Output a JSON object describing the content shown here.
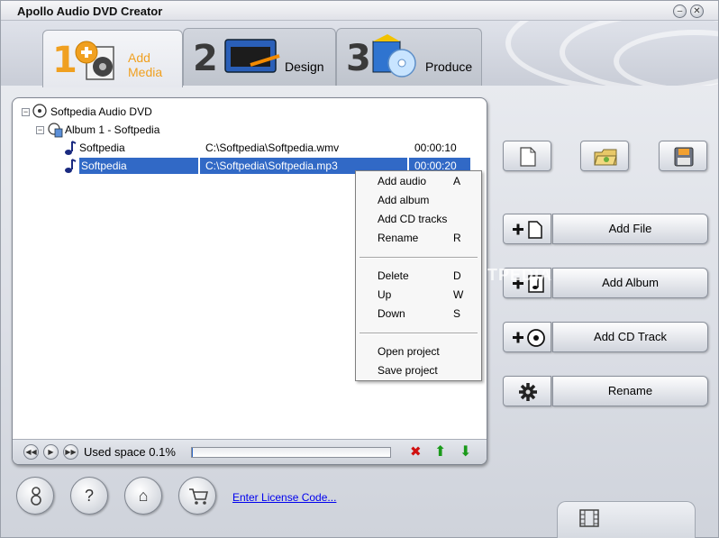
{
  "window": {
    "title": "Apollo Audio DVD Creator",
    "minimize_glyph": "–",
    "close_glyph": "✕"
  },
  "steps": [
    {
      "number": "1",
      "label_line1": "Add",
      "label_line2": "Media",
      "icon": "add-media-icon",
      "active": true
    },
    {
      "number": "2",
      "label": "Design",
      "icon": "design-icon",
      "active": false
    },
    {
      "number": "3",
      "label": "Produce",
      "icon": "produce-icon",
      "active": false
    }
  ],
  "tree": {
    "root": "Softpedia Audio DVD",
    "album": "Album 1 - Softpedia",
    "tracks": [
      {
        "name": "Softpedia",
        "path": "C:\\Softpedia\\Softpedia.wmv",
        "duration": "00:00:10",
        "selected": false
      },
      {
        "name": "Softpedia",
        "path": "C:\\Softpedia\\Softpedia.mp3",
        "duration": "00:00:20",
        "selected": true
      }
    ],
    "collapse_glyph": "−"
  },
  "context_menu": {
    "groups": [
      [
        {
          "label": "Add audio",
          "key": "A"
        },
        {
          "label": "Add album",
          "key": ""
        },
        {
          "label": "Add CD tracks",
          "key": ""
        },
        {
          "label": "Rename",
          "key": "R"
        }
      ],
      [
        {
          "label": "Delete",
          "key": "D"
        },
        {
          "label": "Up",
          "key": "W"
        },
        {
          "label": "Down",
          "key": "S"
        }
      ],
      [
        {
          "label": "Open project",
          "key": ""
        },
        {
          "label": "Save project",
          "key": ""
        }
      ]
    ]
  },
  "footer": {
    "used_space": "Used space 0.1%",
    "used_space_fraction": 0.001,
    "rewind_glyph": "◀◀",
    "play_glyph": "▶",
    "forward_glyph": "▶▶",
    "delete_glyph": "✖",
    "up_glyph": "⬆",
    "down_glyph": "⬇"
  },
  "toolbar": {
    "new_icon": "new-document-icon",
    "open_icon": "open-folder-icon",
    "save_icon": "save-disk-icon"
  },
  "actions": [
    {
      "label": "Add File",
      "icon": "add-file-icon"
    },
    {
      "label": "Add Album",
      "icon": "add-album-icon"
    },
    {
      "label": "Add CD Track",
      "icon": "add-cd-track-icon"
    },
    {
      "label": "Rename",
      "icon": "gear-icon"
    }
  ],
  "bottom": {
    "license_link": "Enter License Code...",
    "help_glyph": "?",
    "home_glyph": "⌂"
  },
  "watermark": "SOFTPEDIA",
  "colors": {
    "selection": "#3169c6",
    "tab_number_1": "#f0a020",
    "tab_number_2": "#3a3a3a",
    "delete_red": "#d01010",
    "arrow_green": "#1a9a1a"
  }
}
